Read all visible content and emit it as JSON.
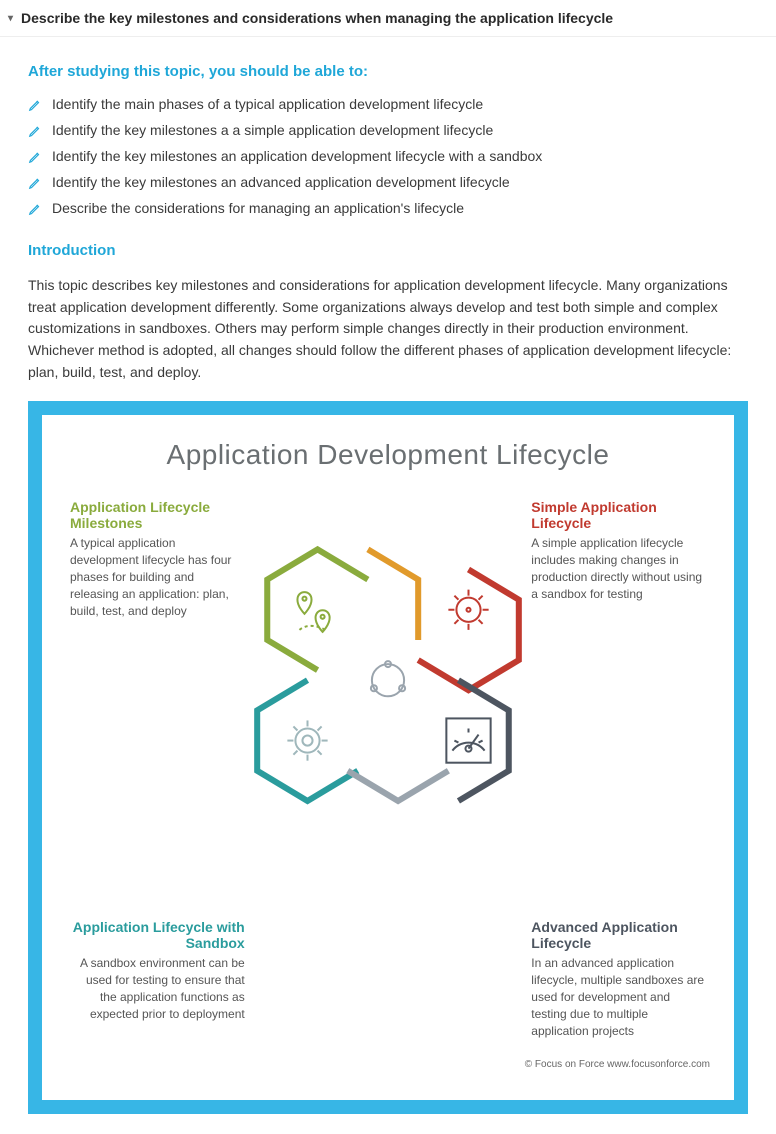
{
  "header": {
    "title": "Describe the key milestones and considerations when managing the application lifecycle"
  },
  "objectives": {
    "heading": "After studying this topic, you should be able to:",
    "items": [
      "Identify the main phases of a typical application development lifecycle",
      "Identify the key milestones a a simple application development lifecycle",
      "Identify the key milestones an application development lifecycle with a sandbox",
      "Identify the key milestones an advanced application development lifecycle",
      "Describe the considerations for managing an application's lifecycle"
    ]
  },
  "introduction": {
    "heading": "Introduction",
    "body": "This topic describes key milestones and considerations for application development lifecycle. Many organizations treat application development differently. Some organizations always develop and test both simple and complex customizations in sandboxes. Others may perform simple changes directly in their production environment. Whichever method is adopted, all changes should follow the different phases of application development lifecycle: plan, build, test, and deploy."
  },
  "diagram": {
    "title": "Application Development Lifecycle",
    "quadrants": {
      "top_left": {
        "title": "Application Lifecycle Milestones",
        "desc": "A typical application development lifecycle has four phases for building and releasing an application: plan, build, test, and deploy"
      },
      "top_right": {
        "title": "Simple Application Lifecycle",
        "desc": "A simple application lifecycle includes making changes in production directly without using a sandbox for testing"
      },
      "bottom_left": {
        "title": "Application Lifecycle with Sandbox",
        "desc": "A sandbox environment can be used for testing to ensure that the application functions as expected prior to deployment"
      },
      "bottom_right": {
        "title": "Advanced Application Lifecycle",
        "desc": "In an advanced application lifecycle, multiple sandboxes are used for development and testing due to multiple application projects"
      }
    },
    "copyright": "© Focus on Force www.focusonforce.com"
  },
  "colors": {
    "blue_accent": "#1fa7d8",
    "frame_blue": "#37b6e6",
    "green": "#8aab3d",
    "orange": "#e19a2b",
    "red": "#c13a2f",
    "teal": "#2a9c9d",
    "slate": "#4d5560",
    "gray": "#9aa4ad"
  }
}
